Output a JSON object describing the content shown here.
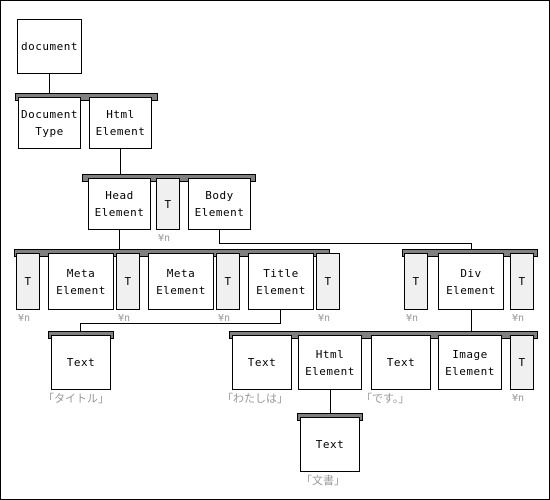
{
  "diagram": {
    "title": "DOM tree diagram",
    "colors": {
      "shelf": "#808080",
      "node_fill": "#ffffff",
      "text_node_fill": "#f0f0f0",
      "caption": "#999999",
      "line": "#000000",
      "background": "#ffffff"
    },
    "escape_label": "¥n",
    "nodes": [
      {
        "id": "document",
        "line1": "document",
        "line2": "",
        "caption": ""
      },
      {
        "id": "doctype",
        "line1": "Document",
        "line2": "Type",
        "caption": ""
      },
      {
        "id": "html",
        "line1": "Html",
        "line2": "Element",
        "caption": ""
      },
      {
        "id": "head",
        "line1": "Head",
        "line2": "Element",
        "caption": ""
      },
      {
        "id": "t-head-body",
        "line1": "T",
        "line2": "",
        "caption": "¥n"
      },
      {
        "id": "body",
        "line1": "Body",
        "line2": "Element",
        "caption": ""
      },
      {
        "id": "t-head-1",
        "line1": "T",
        "line2": "",
        "caption": "¥n"
      },
      {
        "id": "meta-1",
        "line1": "Meta",
        "line2": "Element",
        "caption": ""
      },
      {
        "id": "t-head-2",
        "line1": "T",
        "line2": "",
        "caption": "¥n"
      },
      {
        "id": "meta-2",
        "line1": "Meta",
        "line2": "Element",
        "caption": ""
      },
      {
        "id": "t-head-3",
        "line1": "T",
        "line2": "",
        "caption": "¥n"
      },
      {
        "id": "title",
        "line1": "Title",
        "line2": "Element",
        "caption": ""
      },
      {
        "id": "t-head-4",
        "line1": "T",
        "line2": "",
        "caption": "¥n"
      },
      {
        "id": "t-body-1",
        "line1": "T",
        "line2": "",
        "caption": "¥n"
      },
      {
        "id": "div",
        "line1": "Div",
        "line2": "Element",
        "caption": ""
      },
      {
        "id": "t-body-2",
        "line1": "T",
        "line2": "",
        "caption": "¥n"
      },
      {
        "id": "text-title",
        "line1": "Text",
        "line2": "",
        "caption": "「タイトル」"
      },
      {
        "id": "text-watashi",
        "line1": "Text",
        "line2": "",
        "caption": "「わたしは」"
      },
      {
        "id": "html-inner",
        "line1": "Html",
        "line2": "Element",
        "caption": ""
      },
      {
        "id": "text-desu",
        "line1": "Text",
        "line2": "",
        "caption": "「です。」"
      },
      {
        "id": "image",
        "line1": "Image",
        "line2": "Element",
        "caption": ""
      },
      {
        "id": "t-div-1",
        "line1": "T",
        "line2": "",
        "caption": "¥n"
      },
      {
        "id": "text-bunsho",
        "line1": "Text",
        "line2": "",
        "caption": "「文書」"
      }
    ]
  }
}
